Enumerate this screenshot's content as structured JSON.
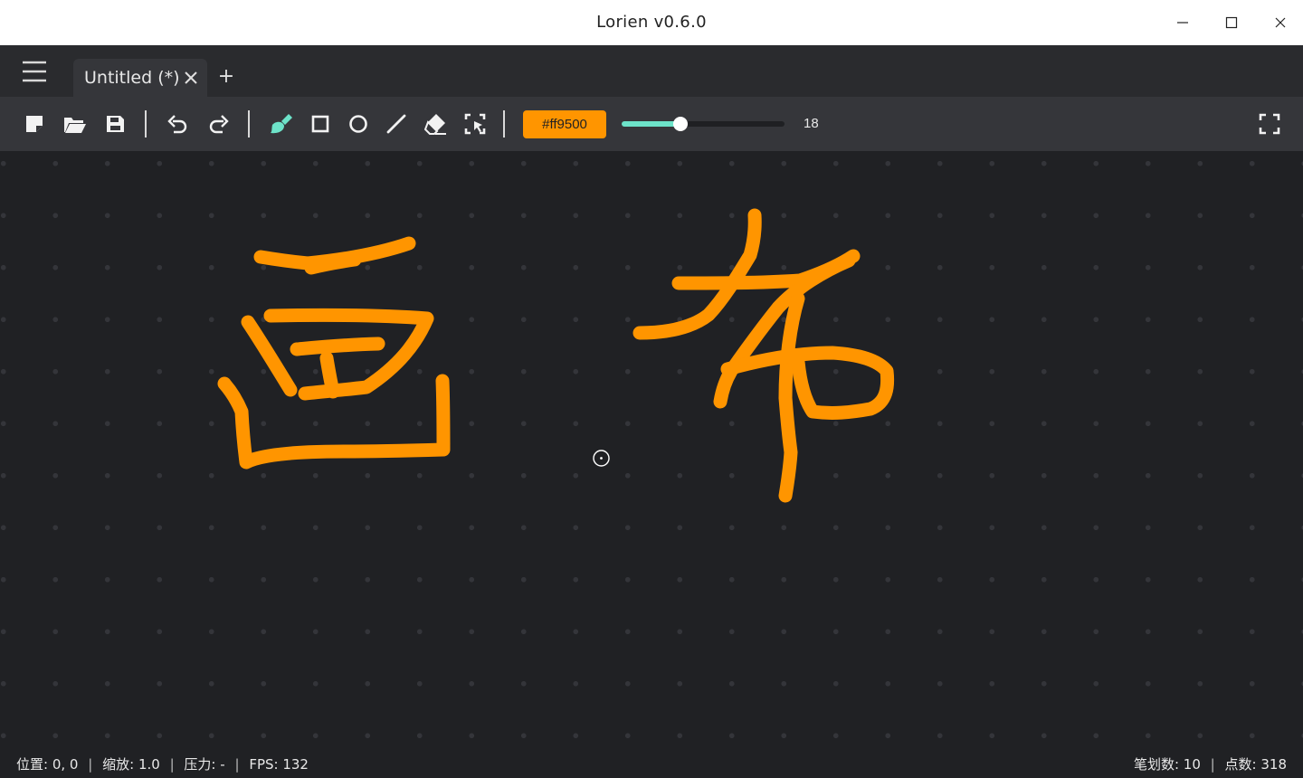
{
  "window": {
    "title": "Lorien v0.6.0"
  },
  "tabs": [
    {
      "label": "Untitled (*)",
      "active": true
    }
  ],
  "new_tab_label": "+",
  "toolbar": {
    "buttons": [
      "new-file-icon",
      "open-folder-icon",
      "save-icon",
      "undo-icon",
      "redo-icon",
      "brush-icon",
      "rectangle-icon",
      "circle-icon",
      "line-icon",
      "eraser-icon",
      "selection-icon",
      "fullscreen-icon"
    ],
    "active_tool": "brush",
    "color": "#ff9500",
    "color_label": "#ff9500",
    "slider_color": "#6de3c9",
    "brush_size_fraction": 0.36,
    "brush_size_label": "18"
  },
  "canvas": {
    "stroke_color": "#ff9500",
    "background": "#202124"
  },
  "status": {
    "position_label": "位置:",
    "position_value": "0, 0",
    "zoom_label": "缩放:",
    "zoom_value": "1.0",
    "pressure_label": "压力:",
    "pressure_value": "-",
    "fps_label": "FPS:",
    "fps_value": "132",
    "strokes_label": "笔划数:",
    "strokes_value": "10",
    "points_label": "点数:",
    "points_value": "318"
  }
}
